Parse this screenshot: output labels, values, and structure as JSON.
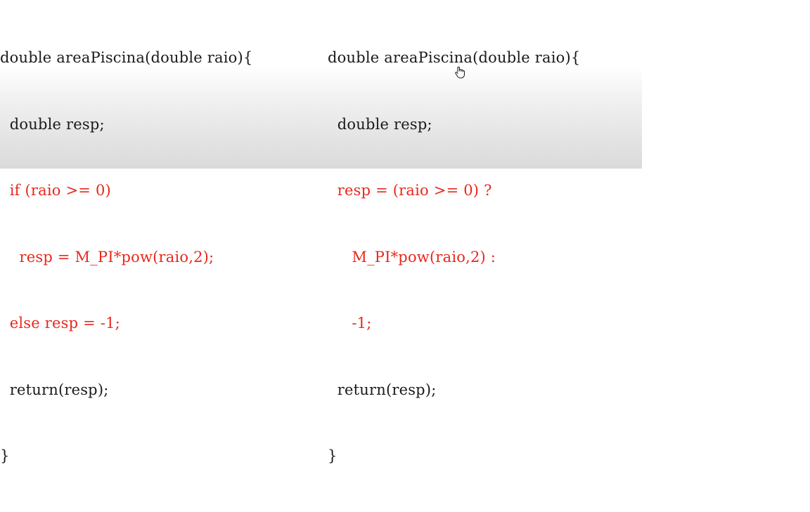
{
  "left_code": {
    "lines": [
      {
        "text": "double areaPiscina(double raio){",
        "highlight": false
      },
      {
        "text": "  double resp;",
        "highlight": false
      },
      {
        "text": "  if (raio >= 0)",
        "highlight": true
      },
      {
        "text": "    resp = M_PI*pow(raio,2);",
        "highlight": true
      },
      {
        "text": "  else resp = -1;",
        "highlight": true
      },
      {
        "text": "  return(resp);",
        "highlight": false
      },
      {
        "text": "}",
        "highlight": false
      }
    ]
  },
  "right_code": {
    "lines": [
      {
        "text": "double areaPiscina(double raio){",
        "highlight": false
      },
      {
        "text": "  double resp;",
        "highlight": false
      },
      {
        "text": "  resp = (raio >= 0) ?",
        "highlight": true
      },
      {
        "text": "     M_PI*pow(raio,2) :",
        "highlight": true
      },
      {
        "text": "     -1;",
        "highlight": true
      },
      {
        "text": "  return(resp);",
        "highlight": false
      },
      {
        "text": "}",
        "highlight": false
      }
    ]
  },
  "colors": {
    "code_default": "#1a1a1a",
    "code_highlight": "#e8281c"
  },
  "cursor_icon": "hand-pointer-icon"
}
